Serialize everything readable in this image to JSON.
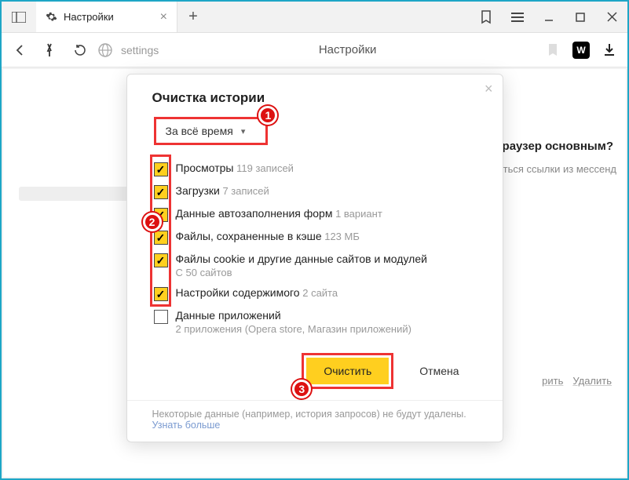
{
  "window": {
    "tab_title": "Настройки",
    "url_path": "settings",
    "url_page_title": "Настройки"
  },
  "bg": {
    "heading_fragment": "раузер основным?",
    "sub_fragment": "аться ссылки из мессенд",
    "link_change": "рить",
    "link_delete": "Удалить"
  },
  "modal": {
    "title": "Очистка истории",
    "range_label": "За всё время",
    "options": [
      {
        "label": "Просмотры",
        "sub": "119 записей",
        "checked": true,
        "inline": true
      },
      {
        "label": "Загрузки",
        "sub": "7 записей",
        "checked": true,
        "inline": true
      },
      {
        "label": "Данные автозаполнения форм",
        "sub": "1 вариант",
        "checked": true,
        "inline": true
      },
      {
        "label": "Файлы, сохраненные в кэше",
        "sub": "123 МБ",
        "checked": true,
        "inline": true
      },
      {
        "label": "Файлы cookie и другие данные сайтов и модулей",
        "sub": "С 50 сайтов",
        "checked": true,
        "inline": false
      },
      {
        "label": "Настройки содержимого",
        "sub": "2 сайта",
        "checked": true,
        "inline": true
      },
      {
        "label": "Данные приложений",
        "sub": "2 приложения (Opera store, Магазин приложений)",
        "checked": false,
        "inline": false
      }
    ],
    "btn_primary": "Очистить",
    "btn_secondary": "Отмена",
    "footer_text": "Некоторые данные (например, история запросов) не будут удалены.",
    "footer_link": "Узнать больше"
  },
  "markers": {
    "m1": "1",
    "m2": "2",
    "m3": "3"
  },
  "vk_label": "W"
}
